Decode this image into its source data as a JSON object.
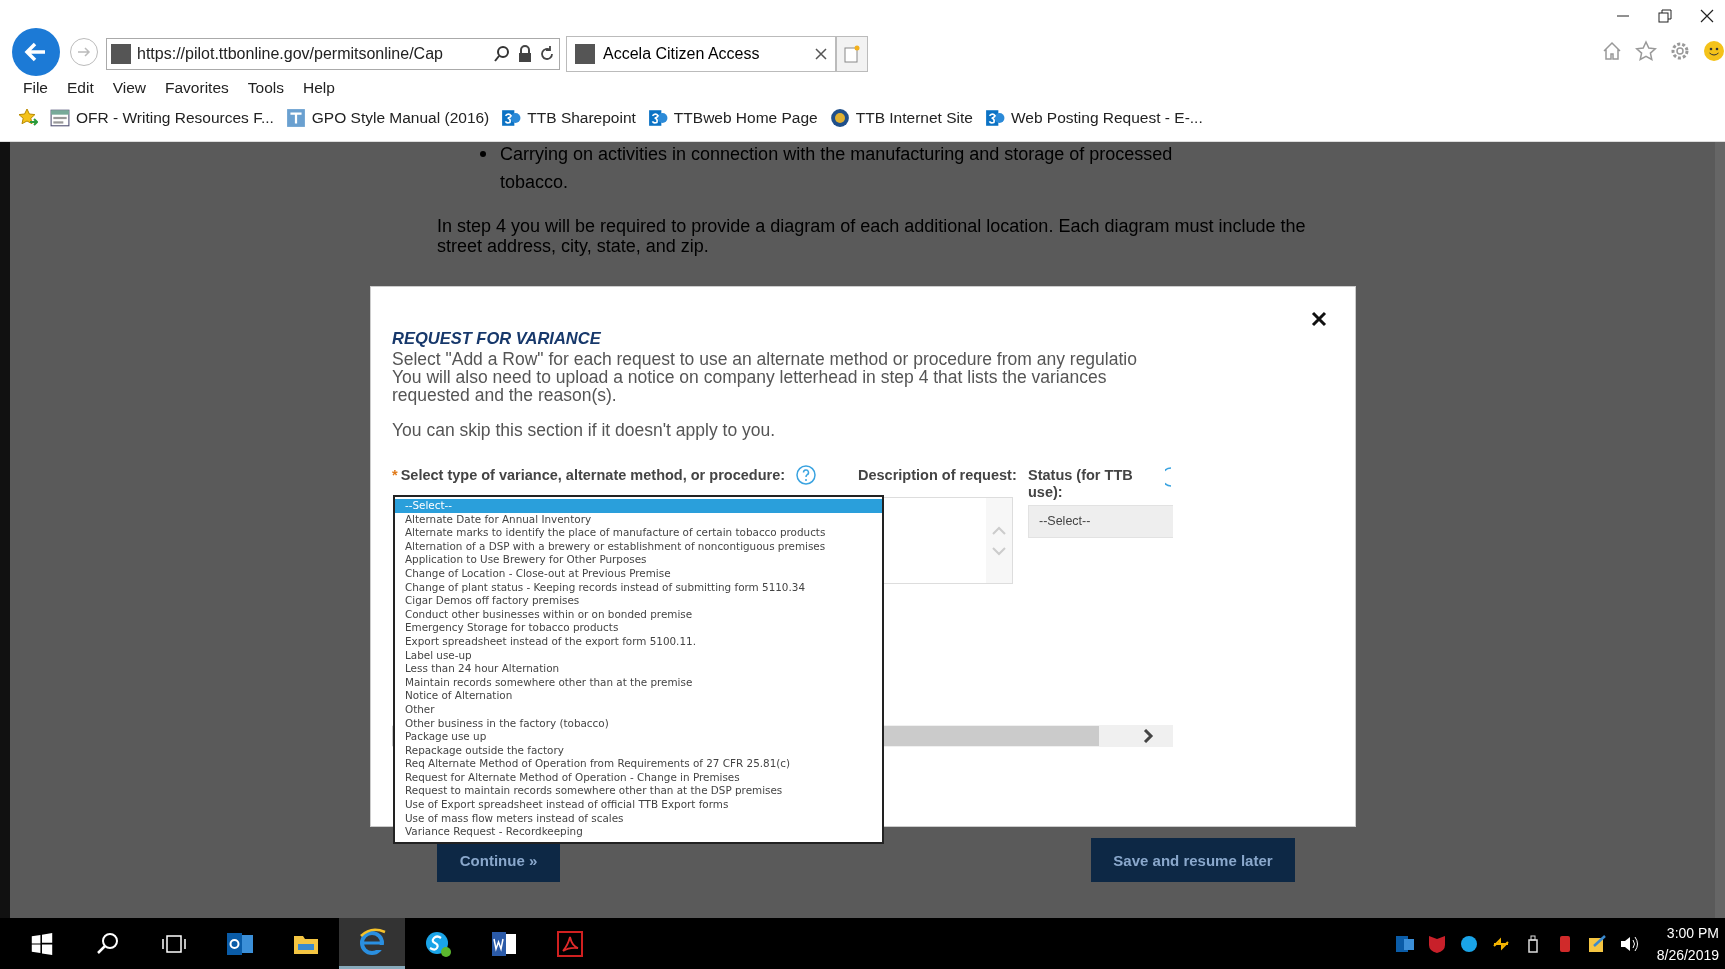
{
  "browser": {
    "address": "https://pilot.ttbonline.gov/permitsonline/Cap",
    "tab_title": "Accela Citizen Access",
    "menu": [
      "File",
      "Edit",
      "View",
      "Favorites",
      "Tools",
      "Help"
    ],
    "favorites": [
      {
        "label": "OFR - Writing Resources F...",
        "kind": "page"
      },
      {
        "label": "GPO Style Manual (2016)",
        "kind": "doc"
      },
      {
        "label": "TTB Sharepoint",
        "kind": "sharepoint"
      },
      {
        "label": "TTBweb Home Page",
        "kind": "sharepoint"
      },
      {
        "label": "TTB Internet Site",
        "kind": "seal"
      },
      {
        "label": "Web Posting Request - E-...",
        "kind": "sharepoint"
      }
    ]
  },
  "page": {
    "bullet": "Carrying on activities in connection with the manufacturing and storage of processed tobacco.",
    "paragraph": "In step 4 you will be required to provide a diagram of each additional location. Each diagram must include the street address, city, state, and zip.",
    "continue_button": "Continue »",
    "save_button": "Save and resume later"
  },
  "modal": {
    "title": "REQUEST FOR VARIANCE",
    "lines": [
      "Select \"Add a Row\" for each request to use an alternate method or procedure from any regulatio",
      "You will also need to upload a notice on company letterhead in step 4 that lists the variances",
      "requested and the reason(s)."
    ],
    "skip_note": "You can skip this section if it doesn't apply to you.",
    "required_mark": "*",
    "type_label": "Select type of variance, alternate method, or procedure:",
    "description_label": "Description of request:",
    "status_label": "Status (for TTB use):",
    "status_value": "--Select--",
    "variance_options": [
      {
        "label": "--Select--",
        "selected": true
      },
      {
        "label": "Alternate Date for Annual Inventory",
        "selected": false
      },
      {
        "label": "Alternate marks to identify the place of manufacture of certain tobacco products",
        "selected": false
      },
      {
        "label": "Alternation of a DSP with a brewery or establishment of noncontiguous premises",
        "selected": false
      },
      {
        "label": "Application to Use Brewery for Other Purposes",
        "selected": false
      },
      {
        "label": "Change of Location - Close-out at Previous Premise",
        "selected": false
      },
      {
        "label": "Change of plant status - Keeping records instead of submitting form 5110.34",
        "selected": false
      },
      {
        "label": "Cigar Demos off factory premises",
        "selected": false
      },
      {
        "label": "Conduct other businesses within or on bonded premise",
        "selected": false
      },
      {
        "label": "Emergency Storage for tobacco products",
        "selected": false
      },
      {
        "label": "Export spreadsheet instead of the export form 5100.11.",
        "selected": false
      },
      {
        "label": "Label use-up",
        "selected": false
      },
      {
        "label": "Less than 24 hour Alternation",
        "selected": false
      },
      {
        "label": "Maintain records somewhere other than at the premise",
        "selected": false
      },
      {
        "label": "Notice of Alternation",
        "selected": false
      },
      {
        "label": "Other",
        "selected": false
      },
      {
        "label": "Other business in the factory (tobacco)",
        "selected": false
      },
      {
        "label": "Package use up",
        "selected": false
      },
      {
        "label": "Repackage outside the factory",
        "selected": false
      },
      {
        "label": "Req Alternate Method of Operation from Requirements of 27 CFR 25.81(c)",
        "selected": false
      },
      {
        "label": "Request for Alternate Method of Operation - Change in Premises",
        "selected": false
      },
      {
        "label": "Request to maintain records somewhere other than at the DSP premises",
        "selected": false
      },
      {
        "label": "Use of Export spreadsheet instead of official TTB Export forms",
        "selected": false
      },
      {
        "label": "Use of mass flow meters instead of scales",
        "selected": false
      },
      {
        "label": "Variance Request - Recordkeeping",
        "selected": false
      }
    ]
  },
  "taskbar": {
    "time": "3:00 PM",
    "date": "8/26/2019"
  }
}
